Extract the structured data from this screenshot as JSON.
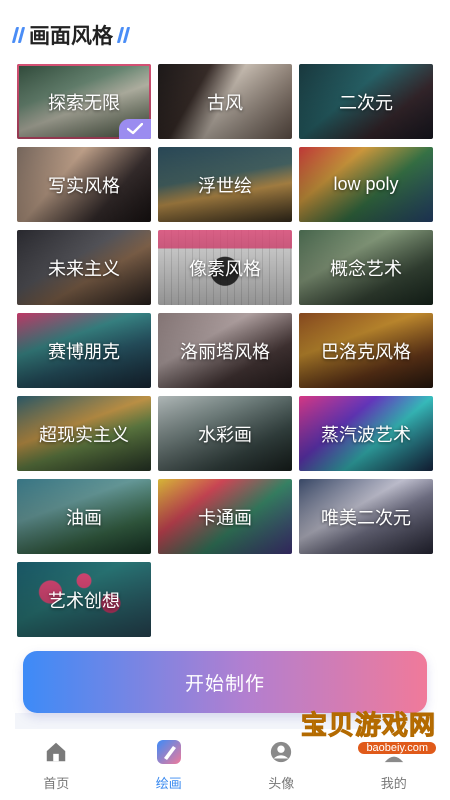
{
  "section": {
    "title": "画面风格"
  },
  "styles": [
    {
      "label": "探索无限",
      "selected": true
    },
    {
      "label": "古风"
    },
    {
      "label": "二次元"
    },
    {
      "label": "写实风格"
    },
    {
      "label": "浮世绘"
    },
    {
      "label": "low poly"
    },
    {
      "label": "未来主义"
    },
    {
      "label": "像素风格"
    },
    {
      "label": "概念艺术"
    },
    {
      "label": "赛博朋克"
    },
    {
      "label": "洛丽塔风格"
    },
    {
      "label": "巴洛克风格"
    },
    {
      "label": "超现实主义"
    },
    {
      "label": "水彩画"
    },
    {
      "label": "蒸汽波艺术"
    },
    {
      "label": "油画"
    },
    {
      "label": "卡通画"
    },
    {
      "label": "唯美二次元"
    },
    {
      "label": "艺术创想"
    }
  ],
  "start_button": {
    "label": "开始制作"
  },
  "tabbar": {
    "items": [
      {
        "label": "首页",
        "icon": "home-icon"
      },
      {
        "label": "绘画",
        "icon": "paint-brush-icon",
        "active": true
      },
      {
        "label": "头像",
        "icon": "avatar-icon"
      },
      {
        "label": "我的",
        "icon": "profile-icon"
      }
    ]
  },
  "watermark": {
    "logo": "宝贝游戏网",
    "url": "baobeiy.com"
  },
  "colors": {
    "accent": "#3a8af0",
    "selected_border": "#e0557a",
    "check_bg": "#9b8cf0"
  }
}
